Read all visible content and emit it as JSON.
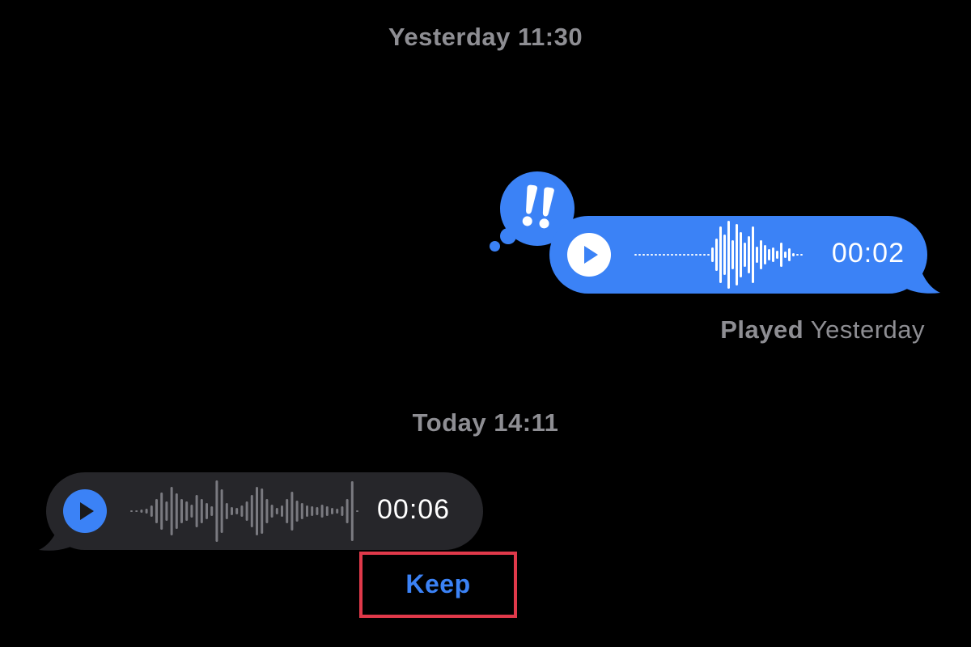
{
  "conversation": {
    "timestamp_first": "Yesterday 11:30",
    "timestamp_second": "Today 14:11"
  },
  "outgoing_audio": {
    "duration": "00:02",
    "bubble_color": "#3b82f6",
    "play_icon": "play-icon",
    "reaction": {
      "icon": "double-exclamation-icon",
      "glyph": "‼"
    },
    "receipt_status": "Played",
    "receipt_time": "Yesterday"
  },
  "incoming_audio": {
    "duration": "00:06",
    "bubble_color": "#26262a",
    "play_icon": "play-icon"
  },
  "actions": {
    "keep_label": "Keep",
    "highlight_color": "#e0394a"
  }
}
